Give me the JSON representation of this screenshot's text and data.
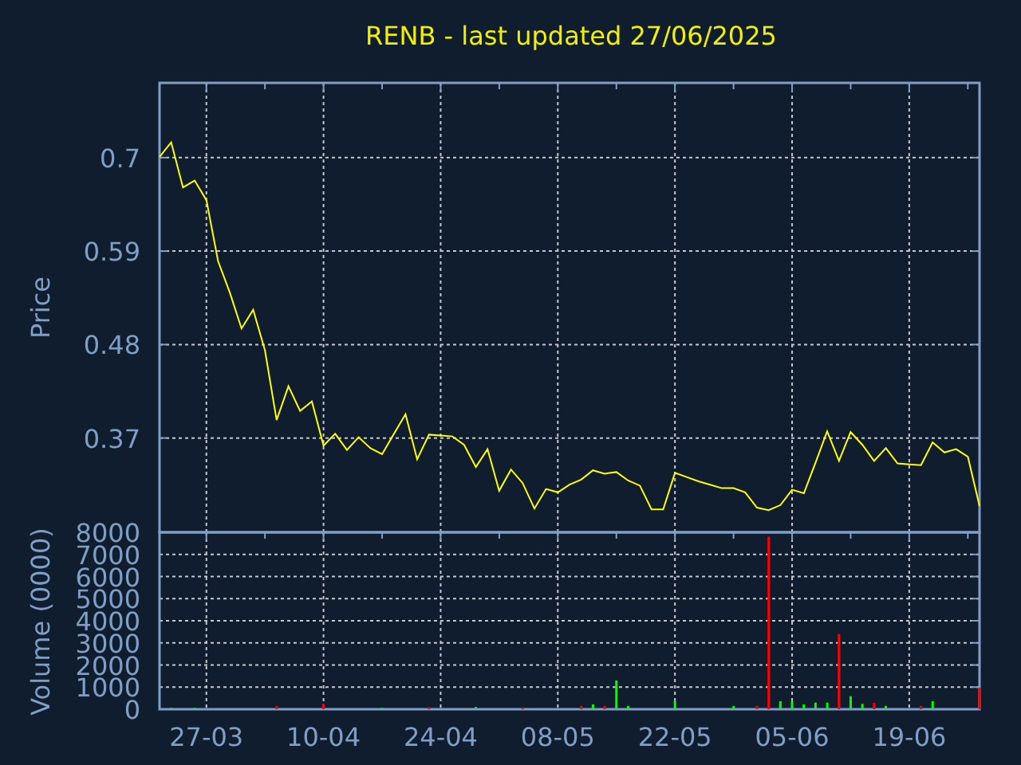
{
  "title": "RENB - last updated 27/06/2025",
  "price_chart": {
    "chart_data": {
      "type": "line",
      "ylabel": "Price",
      "series": [
        {
          "color": "#ffff00",
          "values": [
            0.701,
            0.718,
            0.665,
            0.673,
            0.65,
            0.578,
            0.541,
            0.499,
            0.521,
            0.473,
            0.391,
            0.431,
            0.402,
            0.413,
            0.361,
            0.375,
            0.356,
            0.371,
            0.358,
            0.351,
            0.375,
            0.398,
            0.345,
            0.374,
            0.373,
            0.372,
            0.362,
            0.336,
            0.357,
            0.308,
            0.333,
            0.317,
            0.287,
            0.31,
            0.306,
            0.315,
            0.321,
            0.332,
            0.328,
            0.33,
            0.32,
            0.314,
            0.286,
            0.286,
            0.329,
            0.324,
            0.319,
            0.315,
            0.311,
            0.311,
            0.306,
            0.288,
            0.285,
            0.291,
            0.309,
            0.305,
            0.341,
            0.378,
            0.343,
            0.377,
            0.362,
            0.343,
            0.358,
            0.34,
            0.339,
            0.338,
            0.365,
            0.353,
            0.357,
            0.348,
            0.29
          ]
        }
      ],
      "grid": true,
      "ylim": [
        0.259,
        0.788
      ],
      "yticks": [
        0.37,
        0.48,
        0.59,
        0.7
      ]
    }
  },
  "volume_chart": {
    "chart_data": {
      "type": "bar",
      "ylabel": "Volume (0000)",
      "categories": [
        null,
        null,
        null,
        null,
        "27-03",
        null,
        null,
        null,
        null,
        null,
        null,
        null,
        null,
        null,
        "10-04",
        null,
        null,
        null,
        null,
        null,
        null,
        null,
        null,
        null,
        "24-04",
        null,
        null,
        null,
        null,
        null,
        null,
        null,
        null,
        null,
        "08-05",
        null,
        null,
        null,
        null,
        null,
        null,
        null,
        null,
        null,
        "22-05",
        null,
        null,
        null,
        null,
        null,
        null,
        null,
        null,
        null,
        "05-06",
        null,
        null,
        null,
        null,
        null,
        null,
        null,
        null,
        null,
        "19-06",
        null,
        null,
        null,
        null,
        null,
        null
      ],
      "series": [
        {
          "color": "#ff0000",
          "values": [
            null,
            null,
            null,
            null,
            null,
            null,
            null,
            null,
            null,
            null,
            150,
            null,
            null,
            null,
            240,
            null,
            null,
            null,
            null,
            null,
            null,
            null,
            null,
            100,
            null,
            null,
            null,
            null,
            null,
            null,
            null,
            60,
            null,
            null,
            null,
            null,
            150,
            null,
            150,
            null,
            null,
            null,
            null,
            null,
            null,
            null,
            null,
            null,
            null,
            null,
            null,
            150,
            7800,
            null,
            null,
            null,
            null,
            null,
            3400,
            null,
            null,
            290,
            null,
            null,
            null,
            150,
            null,
            null,
            null,
            null,
            970
          ]
        },
        {
          "color": "#00ff00",
          "values": [
            null,
            60,
            null,
            60,
            null,
            null,
            null,
            null,
            null,
            null,
            null,
            null,
            null,
            null,
            null,
            null,
            null,
            null,
            null,
            60,
            null,
            null,
            null,
            null,
            null,
            null,
            null,
            100,
            null,
            null,
            null,
            null,
            null,
            null,
            null,
            null,
            null,
            220,
            null,
            1300,
            150,
            null,
            null,
            null,
            360,
            null,
            null,
            null,
            null,
            150,
            null,
            null,
            null,
            360,
            360,
            220,
            300,
            300,
            null,
            590,
            240,
            null,
            150,
            null,
            null,
            null,
            360,
            null,
            null,
            null,
            null
          ]
        }
      ],
      "grid": true,
      "ylim": [
        0,
        8000
      ],
      "yticks": [
        0,
        1000,
        2000,
        3000,
        4000,
        5000,
        6000,
        7000,
        8000
      ]
    }
  }
}
